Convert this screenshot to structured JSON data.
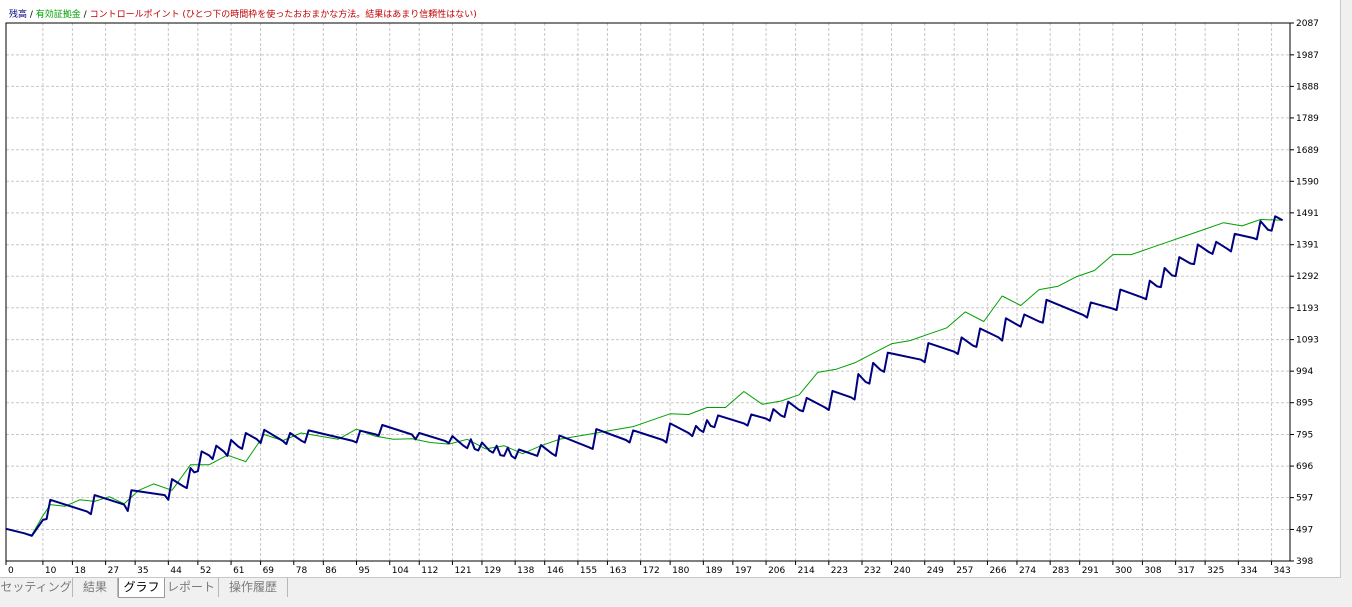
{
  "legend": {
    "balance": "残高",
    "sep1": " / ",
    "equity": "有効証拠金",
    "sep2": " / ",
    "control_points": "コントロールポイント (ひとつ下の時間枠を使ったおおまかな方法。結果はあまり信頼性はない)"
  },
  "tabs": [
    {
      "label": "セッティング"
    },
    {
      "label": "結果"
    },
    {
      "label": "グラフ",
      "active": true
    },
    {
      "label": "レポート"
    },
    {
      "label": "操作履歴"
    }
  ],
  "colors": {
    "balance": "#000080",
    "equity": "#00a000",
    "control": "#c00000",
    "grid": "#c8c8c8",
    "background": "#ffffff"
  },
  "chart_data": {
    "type": "line",
    "xlim": [
      0,
      348
    ],
    "ylim": [
      398,
      2087
    ],
    "x_ticks": [
      0,
      10,
      18,
      27,
      35,
      44,
      52,
      61,
      69,
      78,
      86,
      95,
      104,
      112,
      121,
      129,
      138,
      146,
      155,
      163,
      172,
      180,
      189,
      197,
      206,
      214,
      223,
      232,
      240,
      249,
      257,
      266,
      274,
      283,
      291,
      300,
      308,
      317,
      325,
      334,
      343
    ],
    "y_ticks": [
      398,
      497,
      597,
      696,
      795,
      895,
      994,
      1093,
      1193,
      1292,
      1391,
      1491,
      1590,
      1689,
      1789,
      1888,
      1987,
      2087
    ],
    "series": [
      {
        "name": "残高",
        "x": [
          0,
          5,
          7,
          10,
          11,
          12,
          22,
          23,
          24,
          32,
          33,
          34,
          43,
          44,
          45,
          48,
          49,
          50,
          51,
          52,
          53,
          55,
          56,
          57,
          59,
          60,
          61,
          63,
          64,
          65,
          68,
          69,
          70,
          75,
          76,
          77,
          80,
          81,
          82,
          94,
          95,
          96,
          100,
          101,
          102,
          110,
          111,
          112,
          119,
          120,
          121,
          124,
          125,
          126,
          127,
          128,
          129,
          131,
          132,
          133,
          134,
          135,
          136,
          137,
          138,
          139,
          143,
          144,
          145,
          148,
          149,
          150,
          158,
          159,
          160,
          168,
          169,
          170,
          178,
          179,
          180,
          185,
          186,
          187,
          188,
          189,
          190,
          191,
          192,
          193,
          200,
          201,
          202,
          206,
          207,
          208,
          210,
          211,
          212,
          215,
          216,
          217,
          222,
          223,
          224,
          229,
          230,
          231,
          233,
          234,
          235,
          237,
          238,
          239,
          248,
          249,
          250,
          257,
          258,
          259,
          262,
          263,
          264,
          269,
          270,
          271,
          274,
          275,
          276,
          280,
          281,
          282,
          292,
          293,
          294,
          300,
          301,
          302,
          308,
          309,
          310,
          312,
          313,
          314,
          316,
          317,
          318,
          321,
          322,
          323,
          326,
          327,
          328,
          331,
          332,
          333,
          338,
          339,
          340,
          342,
          343,
          344,
          346
        ],
        "values": [
          499,
          485,
          477,
          527,
          530,
          590,
          553,
          545,
          605,
          575,
          555,
          620,
          605,
          590,
          655,
          633,
          627,
          690,
          676,
          680,
          742,
          730,
          718,
          760,
          742,
          728,
          778,
          757,
          750,
          800,
          780,
          768,
          810,
          775,
          765,
          800,
          776,
          770,
          808,
          775,
          770,
          807,
          796,
          792,
          825,
          795,
          780,
          800,
          775,
          768,
          790,
          760,
          752,
          780,
          750,
          745,
          770,
          745,
          738,
          760,
          730,
          728,
          754,
          728,
          720,
          748,
          732,
          728,
          762,
          735,
          728,
          792,
          755,
          750,
          812,
          778,
          770,
          808,
          778,
          770,
          830,
          800,
          790,
          822,
          810,
          803,
          840,
          822,
          818,
          855,
          830,
          823,
          858,
          845,
          838,
          875,
          855,
          850,
          898,
          872,
          868,
          910,
          880,
          872,
          932,
          912,
          905,
          985,
          960,
          955,
          1020,
          998,
          992,
          1052,
          1030,
          1022,
          1082,
          1055,
          1048,
          1100,
          1075,
          1070,
          1128,
          1100,
          1090,
          1160,
          1140,
          1134,
          1172,
          1150,
          1146,
          1218,
          1170,
          1162,
          1210,
          1190,
          1186,
          1250,
          1225,
          1220,
          1278,
          1260,
          1258,
          1318,
          1295,
          1292,
          1352,
          1332,
          1330,
          1392,
          1368,
          1362,
          1400,
          1378,
          1370,
          1425,
          1412,
          1408,
          1465,
          1438,
          1435,
          1480,
          1468
        ]
      },
      {
        "name": "有効証拠金",
        "x": [
          0,
          5,
          7,
          10,
          12,
          16,
          20,
          24,
          28,
          32,
          36,
          40,
          45,
          50,
          55,
          60,
          65,
          70,
          75,
          80,
          85,
          90,
          95,
          100,
          105,
          110,
          115,
          120,
          125,
          130,
          135,
          140,
          145,
          150,
          155,
          160,
          165,
          170,
          175,
          180,
          185,
          190,
          195,
          200,
          205,
          210,
          215,
          220,
          225,
          230,
          235,
          240,
          245,
          250,
          255,
          260,
          265,
          270,
          275,
          280,
          285,
          290,
          295,
          300,
          305,
          310,
          315,
          320,
          325,
          330,
          335,
          340,
          346
        ],
        "values": [
          499,
          485,
          480,
          540,
          575,
          570,
          590,
          585,
          600,
          578,
          620,
          640,
          620,
          700,
          700,
          730,
          710,
          795,
          776,
          800,
          790,
          780,
          812,
          790,
          780,
          782,
          770,
          765,
          780,
          750,
          760,
          735,
          760,
          780,
          790,
          800,
          810,
          820,
          840,
          860,
          858,
          880,
          880,
          930,
          890,
          900,
          920,
          990,
          1000,
          1020,
          1050,
          1080,
          1090,
          1110,
          1130,
          1180,
          1150,
          1230,
          1200,
          1250,
          1260,
          1290,
          1310,
          1360,
          1360,
          1380,
          1400,
          1420,
          1440,
          1460,
          1450,
          1470,
          1468
        ]
      }
    ]
  }
}
